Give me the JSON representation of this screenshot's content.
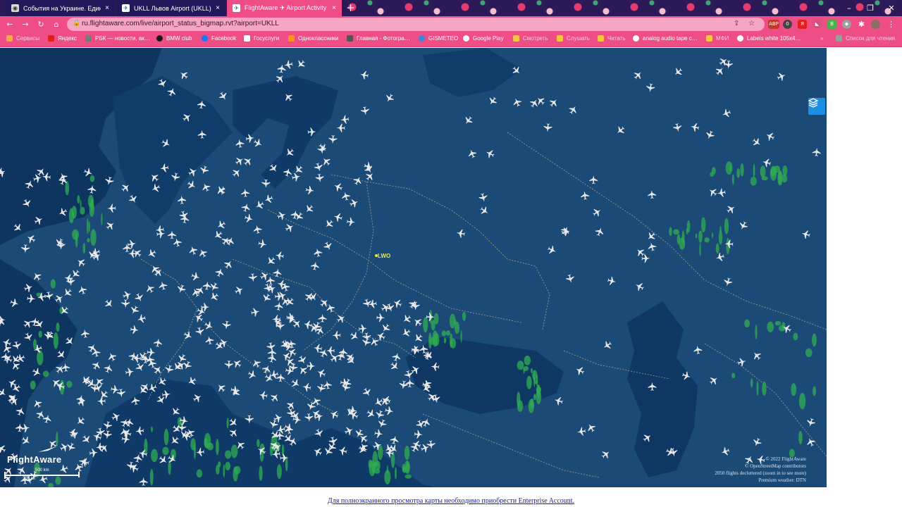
{
  "browser": {
    "tabs": [
      {
        "title": "События на Украине. Единая т…",
        "active": false
      },
      {
        "title": "UKLL Львов Airport (UKLL) - Flig…",
        "active": false
      },
      {
        "title": "FlightAware ✈ Airport Activity …",
        "active": true
      }
    ],
    "url": "ru.flightaware.com/live/airport_status_bigmap.rvt?airport=UKLL",
    "bookmarks": [
      "Сервисы",
      "Яндекс",
      "РБК — новости, ак…",
      "BMW club",
      "Facebook",
      "Госуслуги",
      "Одноклассники",
      "Главная - Фотогра…",
      "GISMETEO",
      "Google Play",
      "Смотреть",
      "Слушать",
      "Читать",
      "analog audio tape c…",
      "МФИ",
      "Labels white 105x4…"
    ],
    "reading_list": "Список для чтения",
    "extensions": [
      "ABP",
      "0",
      "Я",
      "B"
    ]
  },
  "map": {
    "airport_label": "LWO",
    "brand": "FlightAware",
    "scale": {
      "top": "500 km",
      "bottom": "200 mi"
    },
    "attribution": [
      "© 2022 FlightAware",
      "© OpenStreetMap contributors",
      "2050 flights decluttered (zoom in to see more)",
      "Premium weather: DTN"
    ],
    "colors": {
      "sea": "#0e3a66",
      "land": "#255680",
      "weather": "#2fae52",
      "plane": "#e8e8e8",
      "airport": "#f2e640"
    }
  },
  "footer": {
    "link": "Для полноэкранного просмотра карты необходимо приобрести Enterprise Account."
  }
}
